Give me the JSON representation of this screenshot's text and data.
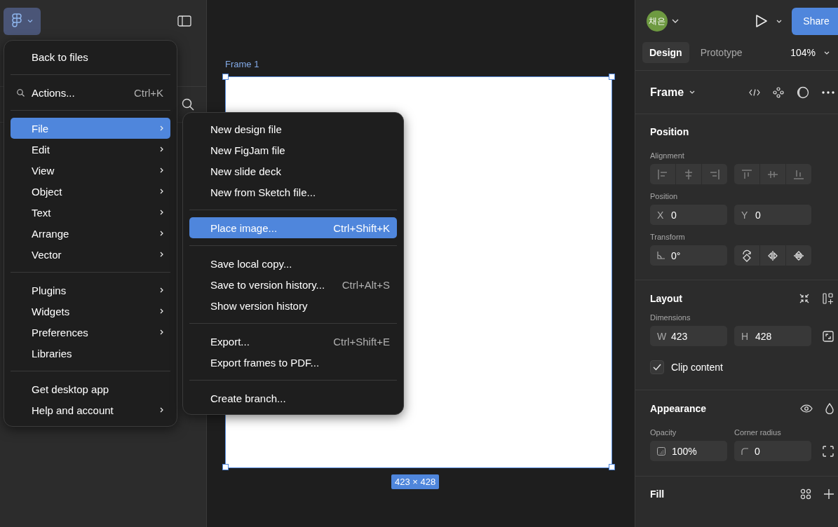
{
  "header": {
    "avatar_initials": "채은",
    "share_label": "Share"
  },
  "main_menu": {
    "sections": [
      [
        {
          "label": "Back to files",
          "kind": "item",
          "submenu": false,
          "selected": false
        }
      ],
      [
        {
          "label": "Actions...",
          "kind": "search",
          "shortcut": "Ctrl+K",
          "submenu": false,
          "selected": false
        }
      ],
      [
        {
          "label": "File",
          "kind": "item",
          "submenu": true,
          "selected": true
        },
        {
          "label": "Edit",
          "kind": "item",
          "submenu": true,
          "selected": false
        },
        {
          "label": "View",
          "kind": "item",
          "submenu": true,
          "selected": false
        },
        {
          "label": "Object",
          "kind": "item",
          "submenu": true,
          "selected": false
        },
        {
          "label": "Text",
          "kind": "item",
          "submenu": true,
          "selected": false
        },
        {
          "label": "Arrange",
          "kind": "item",
          "submenu": true,
          "selected": false
        },
        {
          "label": "Vector",
          "kind": "item",
          "submenu": true,
          "selected": false
        }
      ],
      [
        {
          "label": "Plugins",
          "kind": "item",
          "submenu": true,
          "selected": false
        },
        {
          "label": "Widgets",
          "kind": "item",
          "submenu": true,
          "selected": false
        },
        {
          "label": "Preferences",
          "kind": "item",
          "submenu": true,
          "selected": false
        },
        {
          "label": "Libraries",
          "kind": "item",
          "submenu": false,
          "selected": false
        }
      ],
      [
        {
          "label": "Get desktop app",
          "kind": "item",
          "submenu": false,
          "selected": false
        },
        {
          "label": "Help and account",
          "kind": "item",
          "submenu": true,
          "selected": false
        }
      ]
    ]
  },
  "file_submenu": {
    "sections": [
      [
        {
          "label": "New design file",
          "selected": false
        },
        {
          "label": "New FigJam file",
          "selected": false
        },
        {
          "label": "New slide deck",
          "selected": false
        },
        {
          "label": "New from Sketch file...",
          "selected": false
        }
      ],
      [
        {
          "label": "Place image...",
          "shortcut": "Ctrl+Shift+K",
          "selected": true
        }
      ],
      [
        {
          "label": "Save local copy...",
          "selected": false
        },
        {
          "label": "Save to version history...",
          "shortcut": "Ctrl+Alt+S",
          "selected": false
        },
        {
          "label": "Show version history",
          "selected": false
        }
      ],
      [
        {
          "label": "Export...",
          "shortcut": "Ctrl+Shift+E",
          "selected": false
        },
        {
          "label": "Export frames to PDF...",
          "selected": false
        }
      ],
      [
        {
          "label": "Create branch...",
          "selected": false
        }
      ]
    ]
  },
  "canvas": {
    "frame_name": "Frame 1",
    "size_badge": "423 × 428"
  },
  "tabs": [
    {
      "label": "Design",
      "selected": true
    },
    {
      "label": "Prototype",
      "selected": false
    }
  ],
  "zoom": "104%",
  "selection": {
    "type_label": "Frame"
  },
  "position": {
    "title": "Position",
    "alignment_label": "Alignment",
    "position_label": "Position",
    "x": {
      "label": "X",
      "value": "0"
    },
    "y": {
      "label": "Y",
      "value": "0"
    },
    "transform_label": "Transform",
    "rotation": "0°"
  },
  "layout": {
    "title": "Layout",
    "dimensions_label": "Dimensions",
    "width": {
      "label": "W",
      "value": "423"
    },
    "height": {
      "label": "H",
      "value": "428"
    },
    "clip_content": {
      "label": "Clip content",
      "checked": true
    }
  },
  "appearance": {
    "title": "Appearance",
    "opacity_label": "Opacity",
    "opacity": "100%",
    "corner_radius_label": "Corner radius",
    "corner_radius": "0"
  },
  "fill": {
    "title": "Fill"
  }
}
